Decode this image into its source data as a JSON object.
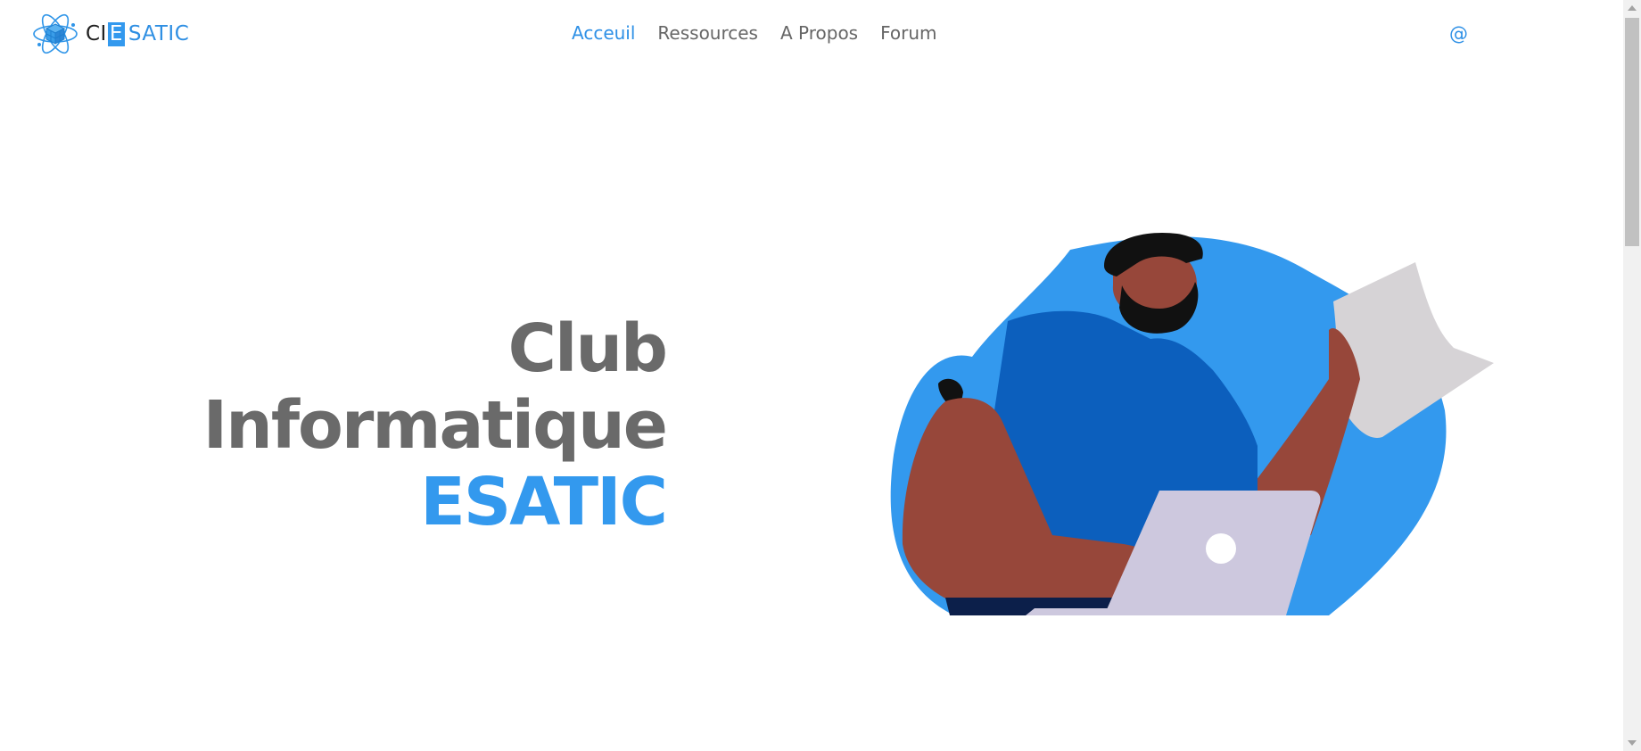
{
  "brand": {
    "part1": "CI",
    "part2": "E",
    "part3": "SATIC"
  },
  "nav": {
    "items": [
      {
        "label": "Acceuil",
        "active": true
      },
      {
        "label": "Ressources",
        "active": false
      },
      {
        "label": "A Propos",
        "active": false
      },
      {
        "label": "Forum",
        "active": false
      }
    ]
  },
  "header": {
    "contact_label": "@"
  },
  "hero": {
    "title_line1": "Club",
    "title_line2": "Informatique",
    "title_line3": "ESATIC"
  },
  "colors": {
    "accent": "#3399ee",
    "nav_text": "#666666",
    "title_text": "#6a6a6a"
  },
  "icons": {
    "logo": "atom-cube-icon",
    "illustration": "man-with-laptop-illustration"
  }
}
